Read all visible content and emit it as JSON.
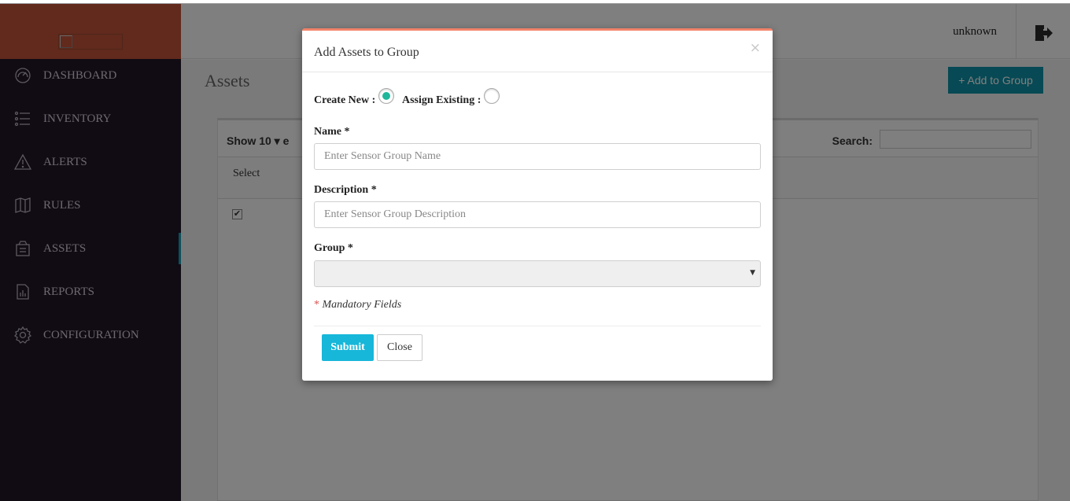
{
  "sidebar": {
    "items": [
      {
        "label": "DASHBOARD",
        "icon": "dashboard-icon"
      },
      {
        "label": "INVENTORY",
        "icon": "list-icon"
      },
      {
        "label": "ALERTS",
        "icon": "warning-icon"
      },
      {
        "label": "RULES",
        "icon": "book-icon"
      },
      {
        "label": "ASSETS",
        "icon": "assets-icon"
      },
      {
        "label": "REPORTS",
        "icon": "report-icon"
      },
      {
        "label": "CONFIGURATION",
        "icon": "gear-icon"
      }
    ],
    "active": "ASSETS"
  },
  "header": {
    "user": "unknown",
    "logout_icon": "logout-icon"
  },
  "page": {
    "title": "Assets",
    "add_button": "+ Add to Group",
    "show_label": "Show  10   ▾  e",
    "search_label": "Search:",
    "column_select": "Select"
  },
  "modal": {
    "title": "Add Assets to Group",
    "close": "×",
    "create_new_label": "Create New :",
    "assign_existing_label": "Assign Existing :",
    "create_new_selected": true,
    "name_label": "Name *",
    "name_placeholder": "Enter Sensor Group Name",
    "description_label": "Description *",
    "description_placeholder": "Enter Sensor Group Description",
    "group_label": "Group *",
    "group_value": "",
    "mandatory_star": "*",
    "mandatory_text": " Mandatory Fields",
    "submit": "Submit",
    "close_button": "Close"
  },
  "colors": {
    "sidebar_bg": "#221628",
    "brand_bg": "#c2543a",
    "accent": "#0f93a8",
    "modal_top": "#f2836a",
    "submit_bg": "#17b7d9",
    "radio_on": "#1fb79b"
  }
}
